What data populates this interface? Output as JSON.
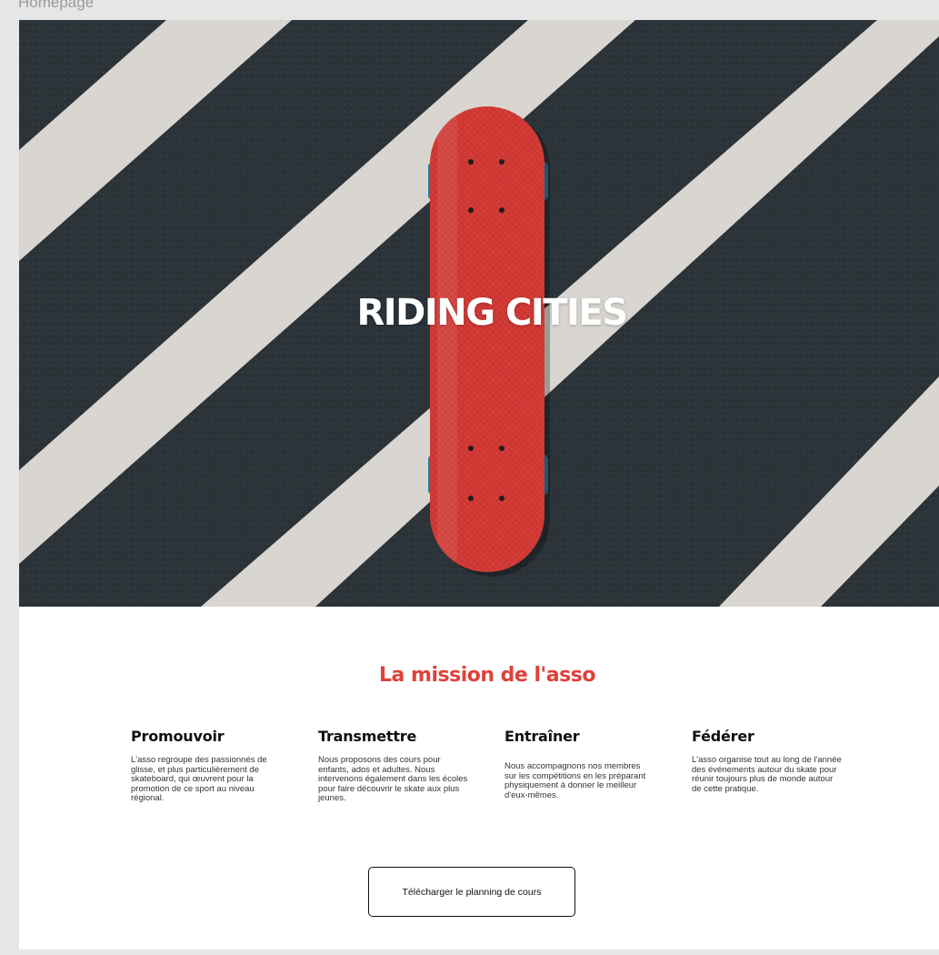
{
  "frame": {
    "label": "Homepage"
  },
  "hero": {
    "title": "RIDING CITIES"
  },
  "mission": {
    "title": "La mission de l'asso",
    "columns": [
      {
        "heading": "Promouvoir",
        "text": "L'asso regroupe des passionnés de glisse, et plus particulièrement de skateboard, qui œuvrent pour la promotion de ce sport au niveau régional."
      },
      {
        "heading": "Transmettre",
        "text": "Nous proposons des cours pour enfants, ados et adultes. Nous intervenons également dans les écoles pour faire découvrir le skate aux plus jeunes."
      },
      {
        "heading": "Entraîner",
        "text": "Nous accompagnons nos membres sur les compétitions en les préparant physiquement à donner le meilleur d'eux-mêmes."
      },
      {
        "heading": "Fédérer",
        "text": "L'asso organise tout au long de l'année des événements autour du skate pour réunir toujours plus de monde autour de cette pratique."
      }
    ]
  },
  "cta": {
    "label": "Télécharger le planning de cours"
  },
  "colors": {
    "accent_red": "#e0413b",
    "asphalt": "#2b3338",
    "stripe": "#d9d5d0",
    "wheel_blue": "#1f7fa5"
  }
}
